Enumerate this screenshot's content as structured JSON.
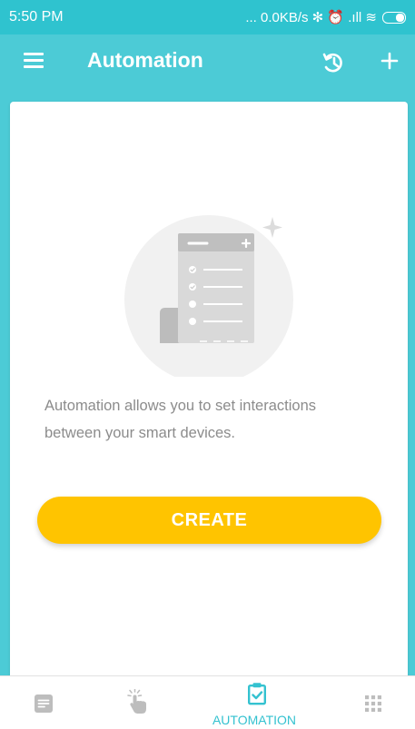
{
  "status_bar": {
    "time": "5:50 PM",
    "indicators": "... 0.0KB/s ✻ ⏰ .ıll ≋"
  },
  "app_bar": {
    "title": "Automation",
    "menu_icon": "hamburger-menu-icon",
    "history_icon": "history-icon",
    "add_icon": "plus-icon"
  },
  "main": {
    "illustration_icon": "automation-list-illustration",
    "description": "Automation allows you to set interactions between your smart devices.",
    "create_label": "CREATE"
  },
  "bottom_nav": {
    "items": [
      {
        "icon": "list-icon",
        "label": ""
      },
      {
        "icon": "tap-hand-icon",
        "label": ""
      },
      {
        "icon": "clipboard-check-icon",
        "label": "AUTOMATION"
      },
      {
        "icon": "grid-icon",
        "label": ""
      }
    ]
  },
  "colors": {
    "status_bar": "#2fc3cf",
    "app_bar": "#4ccbd6",
    "accent": "#34c2d0",
    "create_button": "#ffc400",
    "nav_inactive": "#bdbdbd"
  }
}
